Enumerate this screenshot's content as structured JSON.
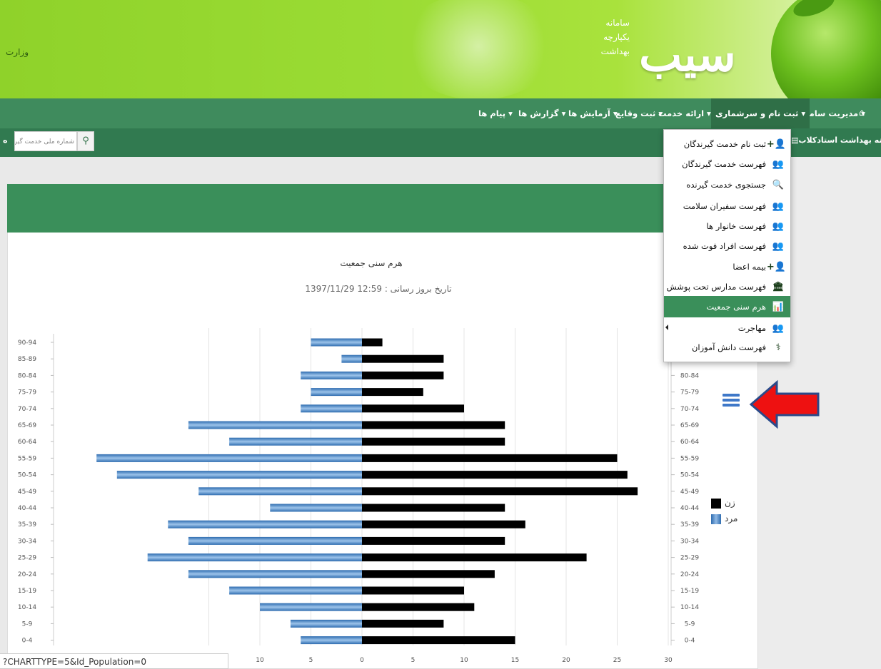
{
  "header": {
    "ministry_text": "وزارت",
    "logo_word": "سیب",
    "logo_sub": [
      "سامانه",
      "یکپارچه",
      "بهداشت"
    ]
  },
  "nav": {
    "home_icon": "home-icon",
    "items": [
      {
        "label": "مدیریت سامانه ▾"
      },
      {
        "label": "ثبت نام و سرشماری ▾"
      },
      {
        "label": "ارائه خدمت ▾"
      },
      {
        "label": "ثبت وقایع ▾"
      },
      {
        "label": "آزمایش ها ▾"
      },
      {
        "label": "گزارش ها ▾"
      },
      {
        "label": "پیام ها ▾"
      }
    ]
  },
  "subbar": {
    "health_house": "خانه بهداشت استادکلاب",
    "search_placeholder": "شماره ملی خدمت گیرنده",
    "left_tail": "ه"
  },
  "dropdown": {
    "items": [
      {
        "label": "ثبت نام خدمت گیرندگان",
        "icon": "add-user-icon",
        "glyph": "👤+"
      },
      {
        "label": "فهرست خدمت گیرندگان",
        "icon": "users-icon",
        "glyph": "👥"
      },
      {
        "label": "جستجوی خدمت گیرنده",
        "icon": "search-icon",
        "glyph": "🔍"
      },
      {
        "label": "فهرست سفیران سلامت",
        "icon": "users-icon",
        "glyph": "👥"
      },
      {
        "label": "فهرست خانوار ها",
        "icon": "users-icon",
        "glyph": "👥"
      },
      {
        "label": "فهرست افراد فوت شده",
        "icon": "users-icon",
        "glyph": "👥"
      },
      {
        "label": "بیمه اعضا",
        "icon": "add-user-icon",
        "glyph": "👤+"
      },
      {
        "label": "فهرست مدارس تحت پوشش",
        "icon": "building-icon",
        "glyph": "🏛"
      },
      {
        "label": "هرم سنی جمعیت",
        "icon": "bar-chart-icon",
        "glyph": "📊",
        "active": true
      },
      {
        "label": "مهاجرت",
        "icon": "users-icon",
        "glyph": "👥"
      },
      {
        "label": "فهرست دانش آموزان",
        "icon": "stethoscope-icon",
        "glyph": "⚕"
      }
    ]
  },
  "status_url": "?CHARTTYPE=5&Id_Population=0",
  "chart_data": {
    "type": "bar",
    "orientation": "horizontal-population-pyramid",
    "title": "هرم سنی جمعیت",
    "subtitle": "تاریخ بروز رسانی : 12:59 1397/11/29",
    "categories": [
      "0-4",
      "5-9",
      "10-14",
      "15-19",
      "20-24",
      "25-29",
      "30-34",
      "35-39",
      "40-44",
      "45-49",
      "50-54",
      "55-59",
      "60-64",
      "65-69",
      "70-74",
      "75-79",
      "80-84",
      "85-89",
      "90-94"
    ],
    "series": [
      {
        "name": "مرد",
        "color": "#4a86c6",
        "values": [
          6,
          7,
          10,
          13,
          17,
          21,
          17,
          19,
          9,
          16,
          24,
          26,
          13,
          17,
          6,
          5,
          6,
          2,
          5
        ]
      },
      {
        "name": "زن",
        "color": "#000000",
        "values": [
          15,
          8,
          11,
          10,
          13,
          22,
          14,
          16,
          14,
          27,
          26,
          25,
          14,
          14,
          10,
          6,
          8,
          8,
          2
        ]
      }
    ],
    "x_ticks": [
      "15",
      "10",
      "5",
      "0",
      "5",
      "10",
      "15",
      "20",
      "25",
      "30"
    ],
    "xlim": [
      -15,
      30
    ],
    "legend_position": "right",
    "colors": {
      "male": "#4a86c6",
      "female": "#000000"
    }
  }
}
